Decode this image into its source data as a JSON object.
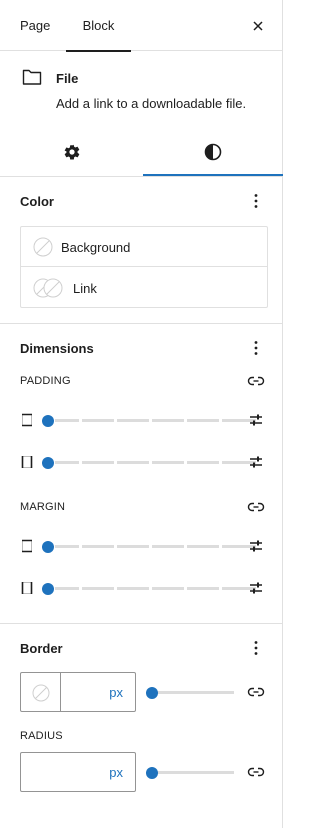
{
  "header": {
    "tabs": [
      {
        "label": "Page"
      },
      {
        "label": "Block"
      }
    ],
    "active_tab": "Block",
    "close_icon": "close-icon"
  },
  "block": {
    "icon": "folder-icon",
    "name": "File",
    "description": "Add a link to a downloadable file."
  },
  "subtabs": {
    "settings_icon": "gear-icon",
    "styles_icon": "half-circle-icon",
    "active": "styles"
  },
  "color": {
    "title": "Color",
    "items": [
      {
        "label": "Background"
      },
      {
        "label": "Link"
      }
    ]
  },
  "dimensions": {
    "title": "Dimensions",
    "padding_label": "PADDING",
    "margin_label": "MARGIN",
    "padding_values": [
      0,
      0
    ],
    "margin_values": [
      0,
      0
    ]
  },
  "border": {
    "title": "Border",
    "width_unit": "px",
    "width_value": "",
    "radius_label": "RADIUS",
    "radius_unit": "px",
    "radius_value": ""
  },
  "colors": {
    "accent": "#1e72bd",
    "border": "#e0e0e0",
    "text": "#1e1e1e"
  }
}
